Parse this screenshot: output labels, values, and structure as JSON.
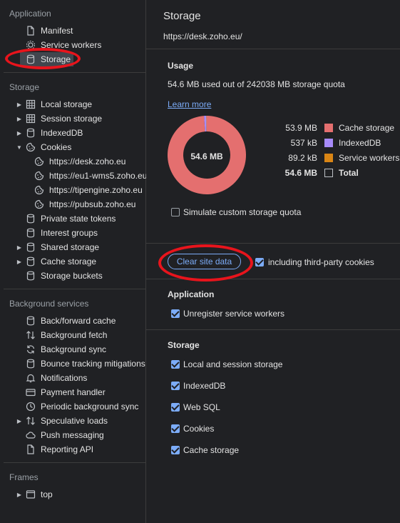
{
  "sidebar": {
    "application_title": "Application",
    "application_items": [
      {
        "label": "Manifest",
        "icon": "document-icon"
      },
      {
        "label": "Service workers",
        "icon": "gear-icon"
      },
      {
        "label": "Storage",
        "icon": "database-icon",
        "selected": true
      }
    ],
    "storage_title": "Storage",
    "storage_items": [
      {
        "label": "Local storage",
        "icon": "grid-icon",
        "expandable": true
      },
      {
        "label": "Session storage",
        "icon": "grid-icon",
        "expandable": true
      },
      {
        "label": "IndexedDB",
        "icon": "database-icon",
        "expandable": true
      },
      {
        "label": "Cookies",
        "icon": "cookie-icon",
        "expanded": true
      },
      {
        "label": "https://desk.zoho.eu",
        "icon": "cookie-icon",
        "child": true
      },
      {
        "label": "https://eu1-wms5.zoho.eu",
        "icon": "cookie-icon",
        "child": true
      },
      {
        "label": "https://tipengine.zoho.eu",
        "icon": "cookie-icon",
        "child": true
      },
      {
        "label": "https://pubsub.zoho.eu",
        "icon": "cookie-icon",
        "child": true
      },
      {
        "label": "Private state tokens",
        "icon": "database-icon"
      },
      {
        "label": "Interest groups",
        "icon": "database-icon"
      },
      {
        "label": "Shared storage",
        "icon": "database-icon",
        "expandable": true
      },
      {
        "label": "Cache storage",
        "icon": "database-icon",
        "expandable": true
      },
      {
        "label": "Storage buckets",
        "icon": "database-icon"
      }
    ],
    "background_title": "Background services",
    "background_items": [
      {
        "label": "Back/forward cache",
        "icon": "database-icon"
      },
      {
        "label": "Background fetch",
        "icon": "arrows-updown-icon"
      },
      {
        "label": "Background sync",
        "icon": "sync-icon"
      },
      {
        "label": "Bounce tracking mitigations",
        "icon": "database-icon"
      },
      {
        "label": "Notifications",
        "icon": "bell-icon"
      },
      {
        "label": "Payment handler",
        "icon": "card-icon"
      },
      {
        "label": "Periodic background sync",
        "icon": "clock-icon"
      },
      {
        "label": "Speculative loads",
        "icon": "arrows-updown-icon",
        "expandable": true
      },
      {
        "label": "Push messaging",
        "icon": "cloud-icon"
      },
      {
        "label": "Reporting API",
        "icon": "document-icon"
      }
    ],
    "frames_title": "Frames",
    "frames_items": [
      {
        "label": "top",
        "icon": "frame-icon",
        "expandable": true
      }
    ]
  },
  "main": {
    "title": "Storage",
    "url": "https://desk.zoho.eu/",
    "usage": {
      "heading": "Usage",
      "summary": "54.6 MB used out of 242038 MB storage quota",
      "learn_more": "Learn more",
      "donut_center": "54.6 MB",
      "legend": [
        {
          "value": "53.9 MB",
          "label": "Cache storage",
          "color": "#e46f6f"
        },
        {
          "value": "537 kB",
          "label": "IndexedDB",
          "color": "#a78bfa"
        },
        {
          "value": "89.2 kB",
          "label": "Service workers",
          "color": "#d98515"
        },
        {
          "value": "54.6 MB",
          "label": "Total",
          "color": "none",
          "bold": true
        }
      ],
      "simulate_label": "Simulate custom storage quota",
      "simulate_checked": false
    },
    "clear": {
      "button_label": "Clear site data",
      "third_party_label": "including third-party cookies",
      "third_party_checked": true
    },
    "application_section": {
      "heading": "Application",
      "options": [
        {
          "label": "Unregister service workers",
          "checked": true
        }
      ]
    },
    "storage_section": {
      "heading": "Storage",
      "options": [
        {
          "label": "Local and session storage",
          "checked": true
        },
        {
          "label": "IndexedDB",
          "checked": true
        },
        {
          "label": "Web SQL",
          "checked": true
        },
        {
          "label": "Cookies",
          "checked": true
        },
        {
          "label": "Cache storage",
          "checked": true
        }
      ]
    }
  },
  "chart_data": {
    "type": "pie",
    "categories": [
      "Cache storage",
      "IndexedDB",
      "Service workers"
    ],
    "values": [
      53.9,
      0.537,
      0.0892
    ],
    "title": "",
    "center_label": "54.6 MB"
  }
}
